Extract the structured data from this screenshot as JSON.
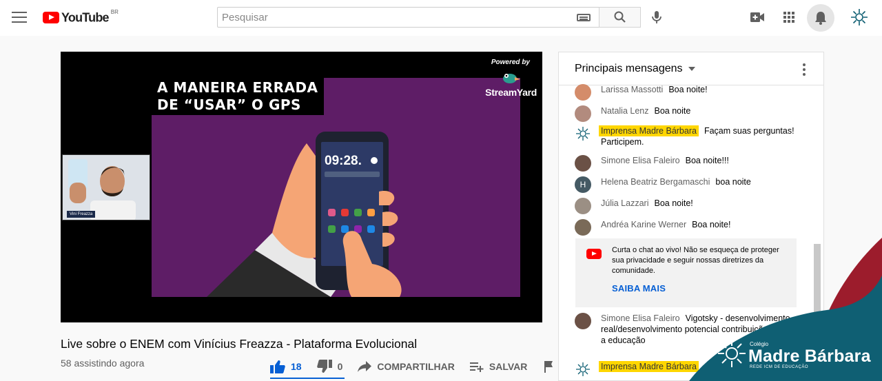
{
  "header": {
    "logo_text": "YouTube",
    "country_code": "BR",
    "search_placeholder": "Pesquisar"
  },
  "video": {
    "headline_line1": "A MANEIRA ERRADA",
    "headline_line2": "DE “USAR” O GPS",
    "phone_time": "09:28",
    "powered_by": "Powered by",
    "streamyard": "StreamYard",
    "cam_name": "Vini Freazza",
    "title": "Live sobre o ENEM com Vinícius Freazza - Plataforma Evolucional",
    "viewers": "58 assistindo agora",
    "likes": "18",
    "dislikes": "0",
    "share_label": "COMPARTILHAR",
    "save_label": "SALVAR",
    "like_ratio": 1.0
  },
  "chat": {
    "header_label": "Principais mensagens",
    "messages": [
      {
        "author": "Larissa Massotti",
        "text": "Boa noite!"
      },
      {
        "author": "Natalia Lenz",
        "text": "Boa noite"
      },
      {
        "author": "Imprensa Madre Bárbara",
        "text": "Façam suas perguntas! Participem.",
        "owner": true
      },
      {
        "author": "Simone Elisa Faleiro",
        "text": "Boa noite!!!"
      },
      {
        "author": "Helena Beatriz Bergamaschi",
        "text": "boa noite",
        "initial": "H"
      },
      {
        "author": "Júlia Lazzari",
        "text": "Boa noite!"
      },
      {
        "author": "Andréa Karine Werner",
        "text": "Boa noite!"
      },
      {
        "author": "Simone Elisa Faleiro",
        "text": "Vigotsky - desenvolvimento real/desenvolvimento potencial contribuições para a educação"
      },
      {
        "author": "Imprensa Madre Bárbara",
        "text": "",
        "owner": true
      }
    ],
    "notice_text": "Curta o chat ao vivo! Não se esqueça de proteger sua privacidade e seguir nossas diretrizes da comunidade.",
    "notice_link": "SAIBA MAIS"
  },
  "brand": {
    "small": "Colégio",
    "name": "Madre Bárbara",
    "sub": "REDE ICM DE EDUCAÇÃO",
    "teal": "#0f5f73",
    "red": "#9c1c2c"
  }
}
